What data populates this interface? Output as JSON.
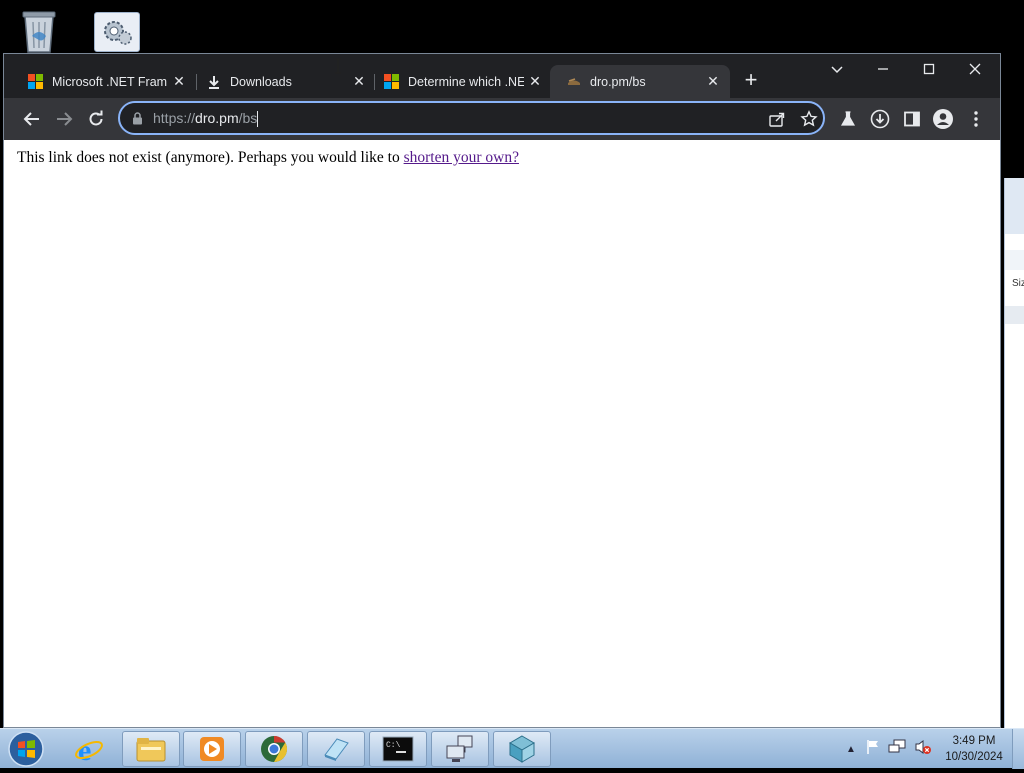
{
  "desktop": {
    "icons": [
      "recycle-bin-icon",
      "control-panel-icon"
    ]
  },
  "browser": {
    "tabs": [
      {
        "title": "Microsoft .NET Fram",
        "icon": "microsoft-logo-icon",
        "active": false
      },
      {
        "title": "Downloads",
        "icon": "download-icon",
        "active": false
      },
      {
        "title": "Determine which .NE",
        "icon": "microsoft-logo-icon",
        "active": false
      },
      {
        "title": "dro.pm/bs",
        "icon": "dropm-favicon-icon",
        "active": true
      }
    ],
    "new_tab_label": "+",
    "window_controls": {
      "dropdown": "⌄",
      "minimize": "–",
      "maximize": "□",
      "close": "✕"
    },
    "address": {
      "scheme": "https://",
      "host": "dro.pm",
      "path": "/bs"
    },
    "page": {
      "message": "This link does not exist (anymore). Perhaps you would like to",
      "link_text": "shorten your own?"
    }
  },
  "background_window": {
    "column_label": "Siz"
  },
  "taskbar": {
    "items": [
      "internet-explorer-icon",
      "file-explorer-icon",
      "media-player-icon",
      "chrome-icon",
      "notepad-icon",
      "cmd-icon",
      "network-icon",
      "component-icon"
    ],
    "clock_time": "3:49 PM",
    "clock_date": "10/30/2024"
  },
  "colors": {
    "tab_strip": "#202124",
    "toolbar": "#35363a",
    "omnibox_focus": "#8ab4f8",
    "link_visited": "#551a8b",
    "taskbar": "#a9c4e2"
  }
}
